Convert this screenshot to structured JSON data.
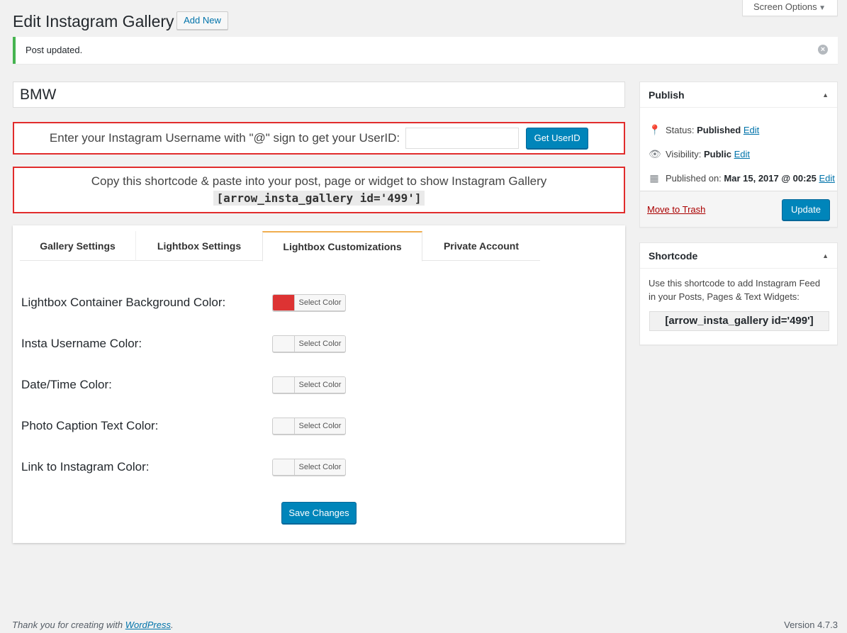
{
  "screen_options": {
    "label": "Screen Options"
  },
  "header": {
    "title": "Edit Instagram Gallery",
    "add_new": "Add New"
  },
  "notice": {
    "message": "Post updated."
  },
  "post": {
    "title": "BMW"
  },
  "userid": {
    "prompt": "Enter your Instagram Username with \"@\" sign to get your UserID:",
    "input_value": "",
    "button": "Get UserID"
  },
  "shortcode_notice": {
    "text": "Copy this shortcode & paste into your post, page or widget to show Instagram Gallery",
    "code": "[arrow_insta_gallery id='499']"
  },
  "tabs": [
    {
      "label": "Gallery Settings",
      "active": false
    },
    {
      "label": "Lightbox Settings",
      "active": false
    },
    {
      "label": "Lightbox Customizations",
      "active": true
    },
    {
      "label": "Private Account",
      "active": false
    }
  ],
  "fields": [
    {
      "label": "Lightbox Container Background Color:",
      "color": "#dd3333",
      "button": "Select Color"
    },
    {
      "label": "Insta Username Color:",
      "color": "#f7f7f7",
      "button": "Select Color"
    },
    {
      "label": "Date/Time Color:",
      "color": "#f7f7f7",
      "button": "Select Color"
    },
    {
      "label": "Photo Caption Text Color:",
      "color": "#f7f7f7",
      "button": "Select Color"
    },
    {
      "label": "Link to Instagram Color:",
      "color": "#f7f7f7",
      "button": "Select Color"
    }
  ],
  "save_button": "Save Changes",
  "publish": {
    "title": "Publish",
    "status_label": "Status:",
    "status_value": "Published",
    "visibility_label": "Visibility:",
    "visibility_value": "Public",
    "published_label": "Published on:",
    "published_value": "Mar 15, 2017 @ 00:25",
    "edit": "Edit",
    "trash": "Move to Trash",
    "update": "Update"
  },
  "shortcode_box": {
    "title": "Shortcode",
    "desc": "Use this shortcode to add Instagram Feed in your Posts, Pages & Text Widgets:",
    "code": "[arrow_insta_gallery id='499']"
  },
  "footer": {
    "thanks": "Thank you for creating with ",
    "wp_link": "WordPress",
    "period": ".",
    "version": "Version 4.7.3"
  }
}
